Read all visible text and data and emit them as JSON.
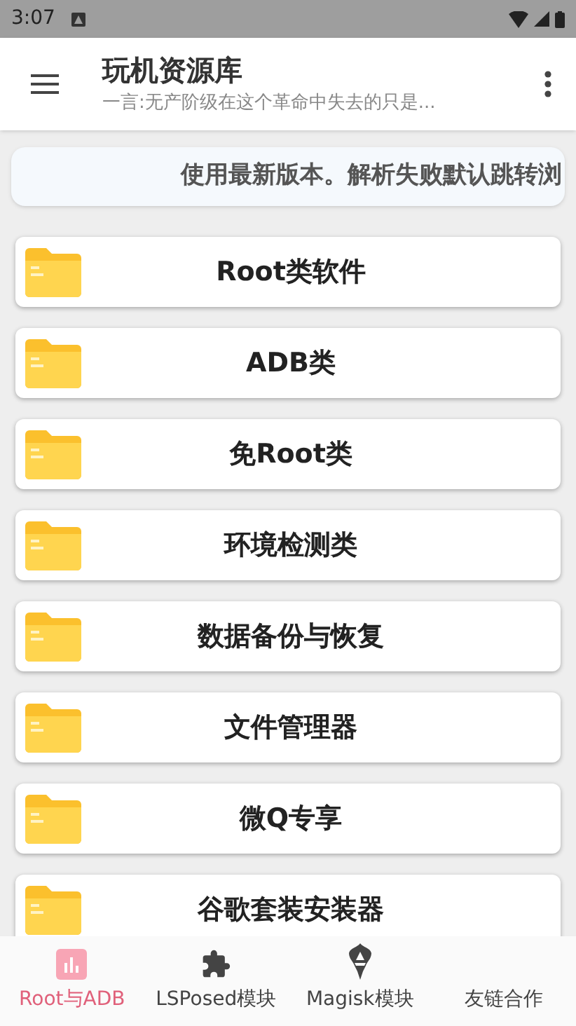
{
  "status_bar": {
    "time": "3:07"
  },
  "app_bar": {
    "title": "玩机资源库",
    "subtitle": "一言:无产阶级在这个革命中失去的只是..."
  },
  "notice": "使用最新版本。解析失败默认跳转浏",
  "folders": [
    {
      "label": "Root类软件"
    },
    {
      "label": "ADB类"
    },
    {
      "label": "免Root类"
    },
    {
      "label": "环境检测类"
    },
    {
      "label": "数据备份与恢复"
    },
    {
      "label": "文件管理器"
    },
    {
      "label": "微Q专享"
    },
    {
      "label": "谷歌套装安装器"
    }
  ],
  "bottom_nav": [
    {
      "label": "Root与ADB",
      "selected": true,
      "kind": "chart"
    },
    {
      "label": "LSPosed模块",
      "selected": false,
      "kind": "puzzle"
    },
    {
      "label": "Magisk模块",
      "selected": false,
      "kind": "mask"
    },
    {
      "label": "友链合作",
      "selected": false,
      "kind": "none"
    }
  ]
}
